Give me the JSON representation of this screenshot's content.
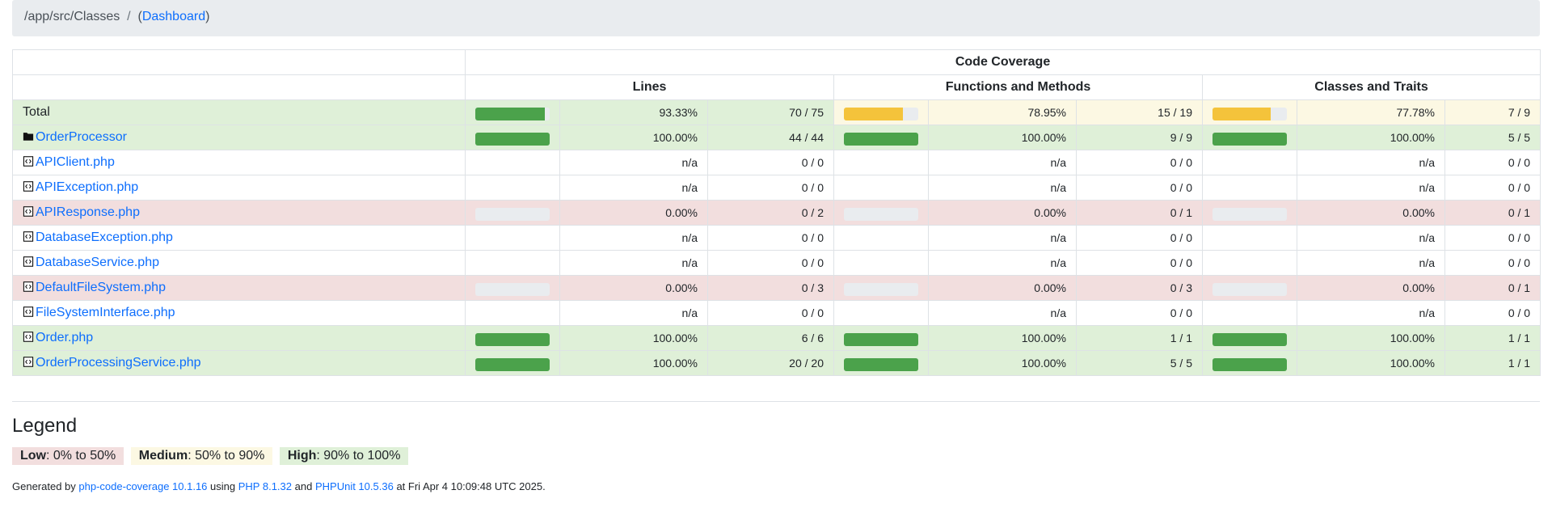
{
  "breadcrumb": {
    "path": "/app/src/Classes",
    "separator": "/",
    "open_paren": "(",
    "link_label": "Dashboard",
    "close_paren": ")"
  },
  "table": {
    "header_group": "Code Coverage",
    "columns": [
      "Lines",
      "Functions and Methods",
      "Classes and Traits"
    ],
    "rows": [
      {
        "name": "Total",
        "link": false,
        "icon": "none",
        "row_class": "success",
        "lines": {
          "pct": "93.33%",
          "count": "70 / 75",
          "bar": 93.33,
          "level": "success"
        },
        "functions": {
          "pct": "78.95%",
          "count": "15 / 19",
          "bar": 78.95,
          "level": "warning"
        },
        "classes": {
          "pct": "77.78%",
          "count": "7 / 9",
          "bar": 77.78,
          "level": "warning"
        }
      },
      {
        "name": "OrderProcessor",
        "link": true,
        "icon": "folder-icon",
        "row_class": "success",
        "lines": {
          "pct": "100.00%",
          "count": "44 / 44",
          "bar": 100,
          "level": "success"
        },
        "functions": {
          "pct": "100.00%",
          "count": "9 / 9",
          "bar": 100,
          "level": "success"
        },
        "classes": {
          "pct": "100.00%",
          "count": "5 / 5",
          "bar": 100,
          "level": "success"
        }
      },
      {
        "name": "APIClient.php",
        "link": true,
        "icon": "file-code-icon",
        "row_class": "",
        "lines": {
          "pct": "n/a",
          "count": "0 / 0",
          "bar": null,
          "level": ""
        },
        "functions": {
          "pct": "n/a",
          "count": "0 / 0",
          "bar": null,
          "level": ""
        },
        "classes": {
          "pct": "n/a",
          "count": "0 / 0",
          "bar": null,
          "level": ""
        }
      },
      {
        "name": "APIException.php",
        "link": true,
        "icon": "file-code-icon",
        "row_class": "",
        "lines": {
          "pct": "n/a",
          "count": "0 / 0",
          "bar": null,
          "level": ""
        },
        "functions": {
          "pct": "n/a",
          "count": "0 / 0",
          "bar": null,
          "level": ""
        },
        "classes": {
          "pct": "n/a",
          "count": "0 / 0",
          "bar": null,
          "level": ""
        }
      },
      {
        "name": "APIResponse.php",
        "link": true,
        "icon": "file-code-icon",
        "row_class": "danger",
        "lines": {
          "pct": "0.00%",
          "count": "0 / 2",
          "bar": 0,
          "level": "danger"
        },
        "functions": {
          "pct": "0.00%",
          "count": "0 / 1",
          "bar": 0,
          "level": "danger"
        },
        "classes": {
          "pct": "0.00%",
          "count": "0 / 1",
          "bar": 0,
          "level": "danger"
        }
      },
      {
        "name": "DatabaseException.php",
        "link": true,
        "icon": "file-code-icon",
        "row_class": "",
        "lines": {
          "pct": "n/a",
          "count": "0 / 0",
          "bar": null,
          "level": ""
        },
        "functions": {
          "pct": "n/a",
          "count": "0 / 0",
          "bar": null,
          "level": ""
        },
        "classes": {
          "pct": "n/a",
          "count": "0 / 0",
          "bar": null,
          "level": ""
        }
      },
      {
        "name": "DatabaseService.php",
        "link": true,
        "icon": "file-code-icon",
        "row_class": "",
        "lines": {
          "pct": "n/a",
          "count": "0 / 0",
          "bar": null,
          "level": ""
        },
        "functions": {
          "pct": "n/a",
          "count": "0 / 0",
          "bar": null,
          "level": ""
        },
        "classes": {
          "pct": "n/a",
          "count": "0 / 0",
          "bar": null,
          "level": ""
        }
      },
      {
        "name": "DefaultFileSystem.php",
        "link": true,
        "icon": "file-code-icon",
        "row_class": "danger",
        "lines": {
          "pct": "0.00%",
          "count": "0 / 3",
          "bar": 0,
          "level": "danger"
        },
        "functions": {
          "pct": "0.00%",
          "count": "0 / 3",
          "bar": 0,
          "level": "danger"
        },
        "classes": {
          "pct": "0.00%",
          "count": "0 / 1",
          "bar": 0,
          "level": "danger"
        }
      },
      {
        "name": "FileSystemInterface.php",
        "link": true,
        "icon": "file-code-icon",
        "row_class": "",
        "lines": {
          "pct": "n/a",
          "count": "0 / 0",
          "bar": null,
          "level": ""
        },
        "functions": {
          "pct": "n/a",
          "count": "0 / 0",
          "bar": null,
          "level": ""
        },
        "classes": {
          "pct": "n/a",
          "count": "0 / 0",
          "bar": null,
          "level": ""
        }
      },
      {
        "name": "Order.php",
        "link": true,
        "icon": "file-code-icon",
        "row_class": "success",
        "lines": {
          "pct": "100.00%",
          "count": "6 / 6",
          "bar": 100,
          "level": "success"
        },
        "functions": {
          "pct": "100.00%",
          "count": "1 / 1",
          "bar": 100,
          "level": "success"
        },
        "classes": {
          "pct": "100.00%",
          "count": "1 / 1",
          "bar": 100,
          "level": "success"
        }
      },
      {
        "name": "OrderProcessingService.php",
        "link": true,
        "icon": "file-code-icon",
        "row_class": "success",
        "lines": {
          "pct": "100.00%",
          "count": "20 / 20",
          "bar": 100,
          "level": "success"
        },
        "functions": {
          "pct": "100.00%",
          "count": "5 / 5",
          "bar": 100,
          "level": "success"
        },
        "classes": {
          "pct": "100.00%",
          "count": "1 / 1",
          "bar": 100,
          "level": "success"
        }
      }
    ]
  },
  "legend": {
    "title": "Legend",
    "low_label": "Low",
    "low_range": ": 0% to 50%",
    "medium_label": "Medium",
    "medium_range": ": 50% to 90%",
    "high_label": "High",
    "high_range": ": 90% to 100%"
  },
  "footer": {
    "generated_by": "Generated by",
    "tool": "php-code-coverage 10.1.16",
    "using": "using",
    "php": "PHP 8.1.32",
    "and": "and",
    "phpunit": "PHPUnit 10.5.36",
    "at": "at Fri Apr 4 10:09:48 UTC 2025."
  },
  "colors": {
    "success_bar": "#4ba24b",
    "warning_bar": "#f4c33b",
    "empty_bar": "#e9ecef",
    "success_bg": "#dff0d8",
    "warning_bg": "#fcf8e3",
    "danger_bg": "#f2dede",
    "link": "#0d6efd"
  }
}
